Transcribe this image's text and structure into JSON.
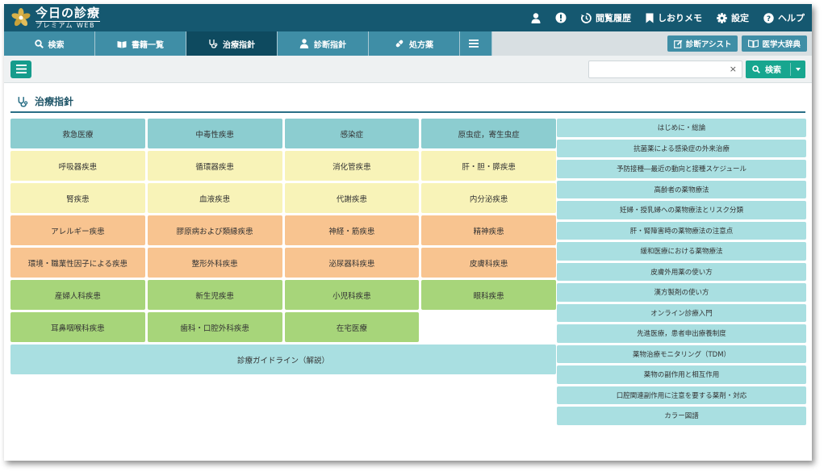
{
  "app": {
    "title": "今日の診療",
    "subtitle": "プレミアム WEB"
  },
  "header": {
    "history_label": "閲覧履歴",
    "bookmark_label": "しおりメモ",
    "settings_label": "設定",
    "help_label": "ヘルプ"
  },
  "tabs": [
    {
      "label": "検索",
      "icon": "search-icon"
    },
    {
      "label": "書籍一覧",
      "icon": "books-icon"
    },
    {
      "label": "治療指針",
      "icon": "stethoscope-icon",
      "active": true
    },
    {
      "label": "診断指針",
      "icon": "doctor-icon"
    },
    {
      "label": "処方薬",
      "icon": "pill-icon"
    }
  ],
  "tab_buttons": {
    "diagnosis_assist": "診断アシスト",
    "medical_dictionary": "医学大辞典"
  },
  "toolbar": {
    "search_value": "",
    "clear_glyph": "×",
    "search_button": "検索"
  },
  "page": {
    "title": "治療指針"
  },
  "grid": {
    "rows": [
      {
        "color": "teal",
        "cells": [
          "救急医療",
          "中毒性疾患",
          "感染症",
          "原虫症，寄生虫症"
        ]
      },
      {
        "color": "yellow",
        "cells": [
          "呼吸器疾患",
          "循環器疾患",
          "消化管疾患",
          "肝・胆・膵疾患"
        ]
      },
      {
        "color": "yellow",
        "cells": [
          "腎疾患",
          "血液疾患",
          "代謝疾患",
          "内分泌疾患"
        ]
      },
      {
        "color": "orange",
        "cells": [
          "アレルギー疾患",
          "膠原病および類縁疾患",
          "神経・筋疾患",
          "精神疾患"
        ]
      },
      {
        "color": "orange",
        "cells": [
          "環境・職業性因子による疾患",
          "整形外科疾患",
          "泌尿器科疾患",
          "皮膚科疾患"
        ]
      },
      {
        "color": "green",
        "cells": [
          "産婦人科疾患",
          "新生児疾患",
          "小児科疾患",
          "眼科疾患"
        ]
      },
      {
        "color": "green",
        "cells": [
          "耳鼻咽喉科疾患",
          "歯科・口腔外科疾患",
          "在宅医療"
        ]
      }
    ],
    "guideline": "診療ガイドライン（解説）"
  },
  "side_items": [
    "はじめに・総論",
    "抗菌薬による感染症の外来治療",
    "予防接種―最近の動向と接種スケジュール",
    "高齢者の薬物療法",
    "妊婦・授乳婦への薬物療法とリスク分類",
    "肝・腎障害時の薬物療法の注意点",
    "緩和医療における薬物療法",
    "皮膚外用薬の使い方",
    "漢方製剤の使い方",
    "オンライン診療入門",
    "先進医療，患者申出療養制度",
    "薬物治療モニタリング（TDM）",
    "薬物の副作用と相互作用",
    "口腔関連副作用に注意を要する薬剤・対応",
    "カラー図譜"
  ],
  "colors": {
    "header": "#155870",
    "tab": "#3f8ea6",
    "tab_active": "#0e4a5f",
    "accent": "#17a68f",
    "teal": "#8ccdd0",
    "yellow": "#f8f3b8",
    "orange": "#f8c490",
    "green": "#a7d57a",
    "side": "#a9dfe1"
  }
}
